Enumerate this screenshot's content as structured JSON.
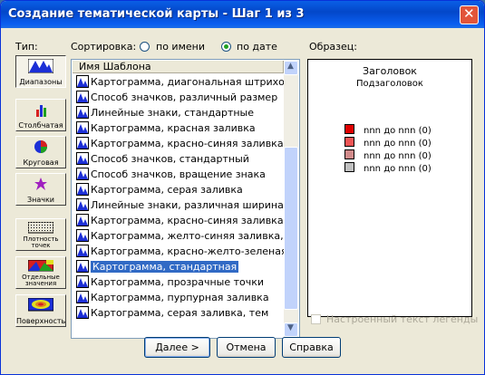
{
  "window": {
    "title": "Создание тематической карты - Шаг 1 из 3"
  },
  "type_panel": {
    "label": "Тип:",
    "buttons": [
      {
        "label": "Диапазоны",
        "icon": "ranges-icon",
        "pressed": true
      },
      {
        "label": "Столбчатая",
        "icon": "bar-chart-icon",
        "pressed": false
      },
      {
        "label": "Круговая",
        "icon": "pie-chart-icon",
        "pressed": false
      },
      {
        "label": "Значки",
        "icon": "star-symbol-icon",
        "pressed": false
      },
      {
        "label": "Плотность точек",
        "icon": "dot-density-icon",
        "pressed": false
      },
      {
        "label": "Отдельные значения",
        "icon": "individual-values-icon",
        "pressed": false
      },
      {
        "label": "Поверхность",
        "icon": "surface-icon",
        "pressed": false
      }
    ]
  },
  "sort": {
    "label": "Сортировка:",
    "options": [
      {
        "label": "по имени",
        "selected": false
      },
      {
        "label": "по дате",
        "selected": true
      }
    ]
  },
  "template_list": {
    "header": "Имя Шаблона",
    "rows": [
      "Картограмма, диагональная штриховка",
      "Способ значков, различный размер",
      "Линейные знаки, стандартные",
      "Картограмма, красная заливка",
      "Картограмма, красно-синяя заливка",
      "Способ значков, стандартный",
      "Способ значков, вращение знака",
      "Картограмма, серая заливка",
      "Линейные знаки, различная ширина",
      "Картограмма, красно-синяя заливка, те",
      "Картограмма, желто-синяя заливка, тем",
      "Картограмма, красно-желто-зеленая за",
      "Картограмма, стандартная",
      "Картограмма, прозрачные точки",
      "Картограмма, пурпурная заливка",
      "Картограмма, серая заливка, тем"
    ],
    "selected_index": 12
  },
  "preview": {
    "label": "Образец:",
    "title": "Заголовок",
    "subtitle": "Подзаголовок",
    "legend": [
      {
        "text": "nnn до nnn   (0)",
        "color": "#e00000"
      },
      {
        "text": "nnn до nnn   (0)",
        "color": "#ee5555"
      },
      {
        "text": "nnn до nnn   (0)",
        "color": "#d08a8a"
      },
      {
        "text": "nnn до nnn   (0)",
        "color": "#c0c0c0"
      }
    ]
  },
  "custom_legend": {
    "label": "Настроенный текст легенды",
    "checked": false,
    "enabled": false
  },
  "buttons": {
    "next": "Далее >",
    "cancel": "Отмена",
    "help": "Справка"
  }
}
